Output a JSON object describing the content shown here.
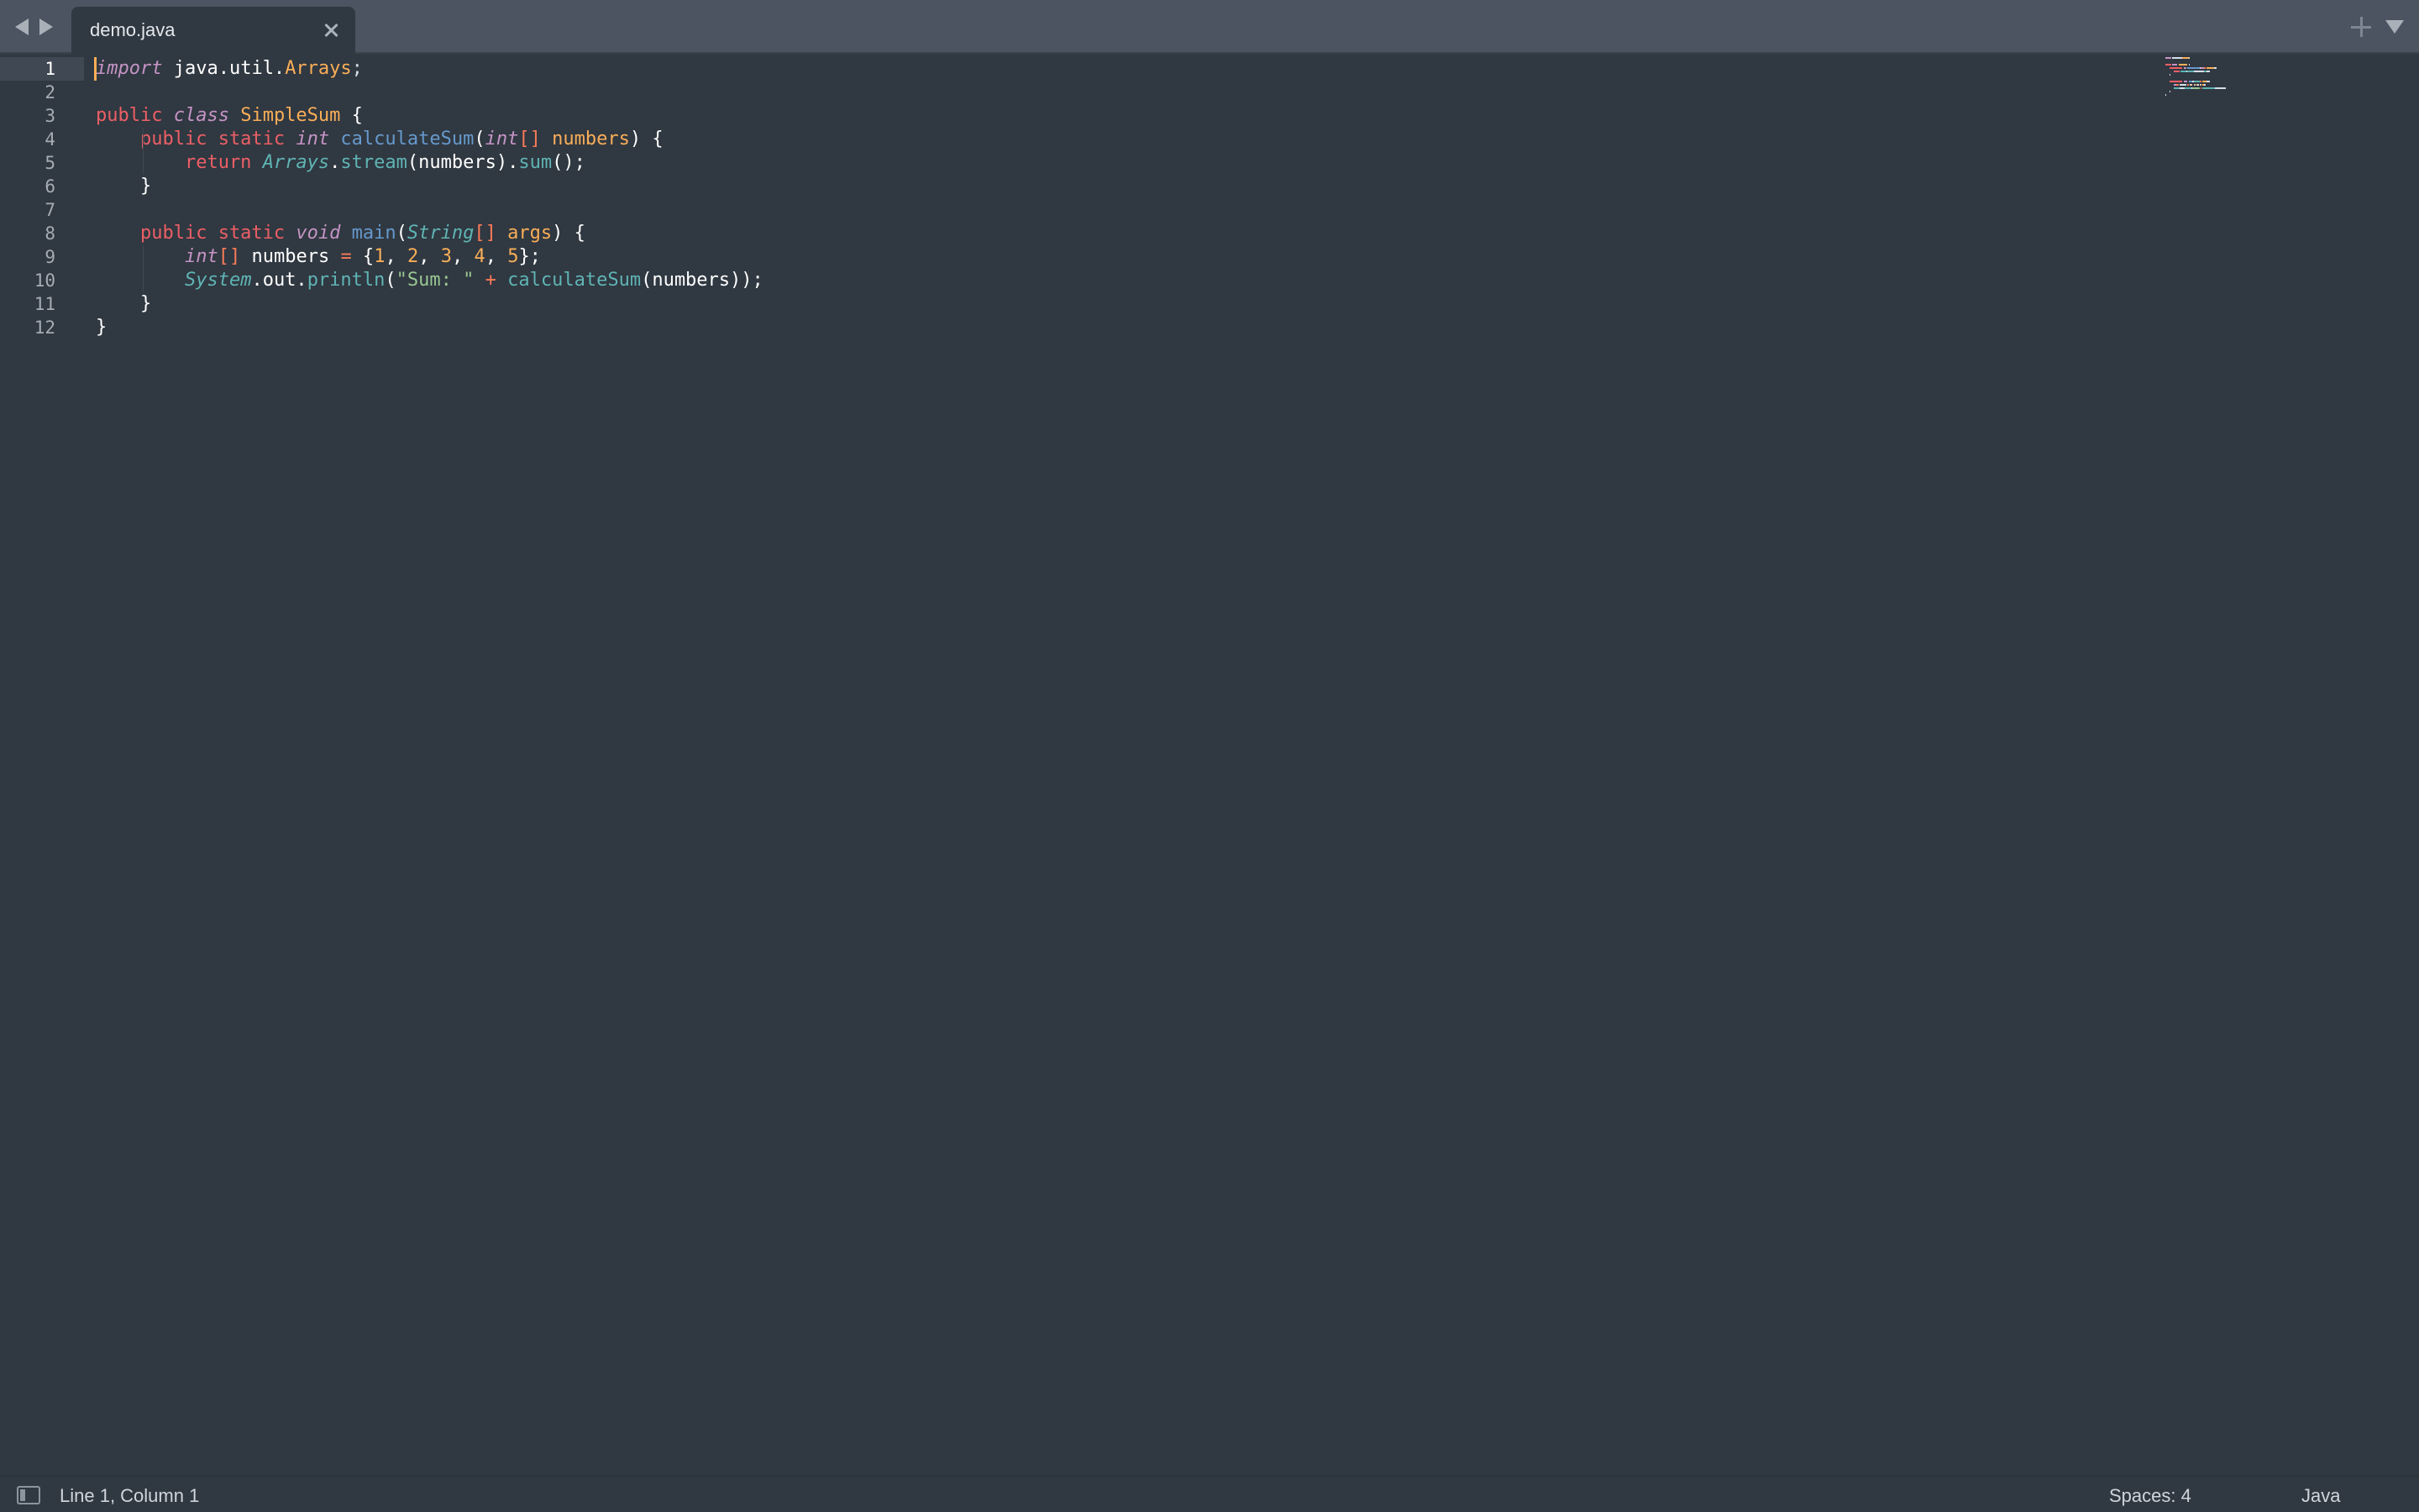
{
  "tabs": [
    {
      "label": "demo.java",
      "active": true
    }
  ],
  "gutter": {
    "line_numbers": [
      "1",
      "2",
      "3",
      "4",
      "5",
      "6",
      "7",
      "8",
      "9",
      "10",
      "11",
      "12"
    ],
    "current_line": "1"
  },
  "code_lines": [
    [
      {
        "t": "import",
        "c": "kwi"
      },
      {
        "t": " java.util.",
        "c": "fg"
      },
      {
        "t": "Arrays",
        "c": "cls"
      },
      {
        "t": ";",
        "c": "pl"
      }
    ],
    [],
    [
      {
        "t": "public ",
        "c": "kw"
      },
      {
        "t": "class ",
        "c": "kwi"
      },
      {
        "t": "SimpleSum",
        "c": "cls"
      },
      {
        "t": " {",
        "c": "fg"
      }
    ],
    [
      {
        "t": "    public static ",
        "c": "kw"
      },
      {
        "t": "int ",
        "c": "ty"
      },
      {
        "t": "calculateSum",
        "c": "fn"
      },
      {
        "t": "(",
        "c": "fg"
      },
      {
        "t": "int",
        "c": "ty"
      },
      {
        "t": "[] ",
        "c": "op"
      },
      {
        "t": "numbers",
        "c": "par"
      },
      {
        "t": ") {",
        "c": "fg"
      }
    ],
    [
      {
        "t": "        return ",
        "c": "kw"
      },
      {
        "t": "Arrays",
        "c": "ty2"
      },
      {
        "t": ".",
        "c": "fg"
      },
      {
        "t": "stream",
        "c": "fn2"
      },
      {
        "t": "(numbers)",
        "c": "fg"
      },
      {
        "t": ".",
        "c": "fg"
      },
      {
        "t": "sum",
        "c": "fn2"
      },
      {
        "t": "();",
        "c": "fg"
      }
    ],
    [
      {
        "t": "    }",
        "c": "fg"
      }
    ],
    [],
    [
      {
        "t": "    public static ",
        "c": "kw"
      },
      {
        "t": "void ",
        "c": "ty"
      },
      {
        "t": "main",
        "c": "fn"
      },
      {
        "t": "(",
        "c": "fg"
      },
      {
        "t": "String",
        "c": "ty2"
      },
      {
        "t": "[] ",
        "c": "op"
      },
      {
        "t": "args",
        "c": "par"
      },
      {
        "t": ") {",
        "c": "fg"
      }
    ],
    [
      {
        "t": "        ",
        "c": "fg"
      },
      {
        "t": "int",
        "c": "ty"
      },
      {
        "t": "[] ",
        "c": "op"
      },
      {
        "t": "numbers ",
        "c": "fg"
      },
      {
        "t": "=",
        "c": "op"
      },
      {
        "t": " {",
        "c": "fg"
      },
      {
        "t": "1",
        "c": "num"
      },
      {
        "t": ", ",
        "c": "fg"
      },
      {
        "t": "2",
        "c": "num"
      },
      {
        "t": ", ",
        "c": "fg"
      },
      {
        "t": "3",
        "c": "num"
      },
      {
        "t": ", ",
        "c": "fg"
      },
      {
        "t": "4",
        "c": "num"
      },
      {
        "t": ", ",
        "c": "fg"
      },
      {
        "t": "5",
        "c": "num"
      },
      {
        "t": "};",
        "c": "fg"
      }
    ],
    [
      {
        "t": "        ",
        "c": "fg"
      },
      {
        "t": "System",
        "c": "ty2"
      },
      {
        "t": ".out.",
        "c": "fg"
      },
      {
        "t": "println",
        "c": "fn2"
      },
      {
        "t": "(",
        "c": "fg"
      },
      {
        "t": "\"Sum: \"",
        "c": "str"
      },
      {
        "t": " + ",
        "c": "op"
      },
      {
        "t": "calculateSum",
        "c": "fn2"
      },
      {
        "t": "(numbers));",
        "c": "fg"
      }
    ],
    [
      {
        "t": "    }",
        "c": "fg"
      }
    ],
    [
      {
        "t": "}",
        "c": "fg"
      }
    ]
  ],
  "status": {
    "position": "Line 1, Column 1",
    "spaces": "Spaces: 4",
    "syntax": "Java"
  },
  "colors": {
    "background": "#303841",
    "tabbar": "#4b5460",
    "caret": "#f9ae58"
  },
  "icons": [
    "back-arrow-icon",
    "forward-arrow-icon",
    "close-icon",
    "plus-icon",
    "chevron-down-icon",
    "sidebar-toggle-icon"
  ]
}
